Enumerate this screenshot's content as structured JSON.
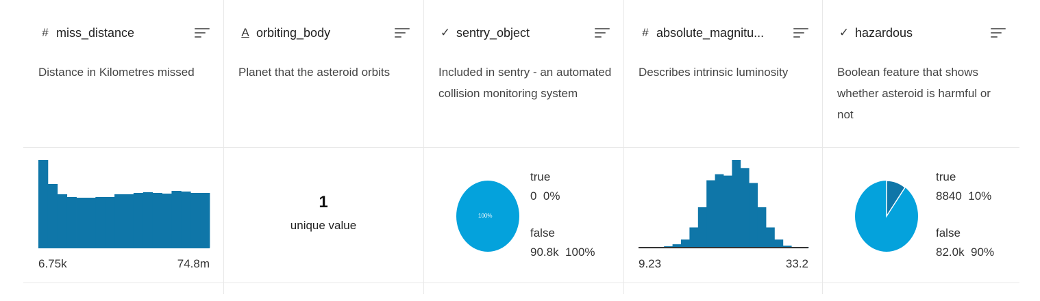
{
  "colors": {
    "histogram": "#0f76a8",
    "pie_main": "#04a2dc",
    "pie_minor": "#0f76a8",
    "grid": "#e8e8e8"
  },
  "columns": [
    {
      "type_icon": "#",
      "name": "miss_distance",
      "description": "Distance in Kilometres missed",
      "viz": "histogram",
      "axis_min": "6.75k",
      "axis_max": "74.8m"
    },
    {
      "type_icon": "A",
      "name": "orbiting_body",
      "description": "Planet that the asteroid orbits",
      "viz": "unique",
      "unique_count": "1",
      "unique_label": "unique value"
    },
    {
      "type_icon": "✓",
      "name": "sentry_object",
      "description": "Included in sentry - an automated collision monitoring system",
      "viz": "boolean",
      "pie_label": "100%",
      "true_label": "true",
      "true_stats": "0  0%",
      "false_label": "false",
      "false_stats": "90.8k  100%"
    },
    {
      "type_icon": "#",
      "name": "absolute_magnitu...",
      "description": "Describes intrinsic luminosity",
      "viz": "histogram",
      "axis_min": "9.23",
      "axis_max": "33.2"
    },
    {
      "type_icon": "✓",
      "name": "hazardous",
      "description": "Boolean feature that shows whether asteroid is harmful or not",
      "viz": "boolean",
      "true_label": "true",
      "true_stats": "8840  10%",
      "false_label": "false",
      "false_stats": "82.0k  90%"
    }
  ],
  "chart_data": [
    {
      "type": "bar",
      "series": [
        {
          "values": [
            128,
            93,
            78,
            74,
            73,
            73,
            74,
            74,
            78,
            78,
            80,
            81,
            80,
            79,
            83,
            82,
            80,
            80
          ]
        }
      ],
      "xlim": [
        "6.75k",
        "74.8m"
      ]
    },
    {
      "type": "bar",
      "series": [
        {
          "values": [
            1,
            1,
            1,
            2,
            5,
            12,
            30,
            60,
            100,
            109,
            107,
            130,
            118,
            96,
            60,
            30,
            12,
            3,
            1,
            1
          ]
        }
      ],
      "xlim": [
        "9.23",
        "33.2"
      ]
    },
    {
      "type": "pie",
      "categories": [
        "true",
        "false"
      ],
      "values": [
        0,
        100
      ]
    },
    {
      "type": "pie",
      "categories": [
        "true",
        "false"
      ],
      "values": [
        10,
        90
      ]
    }
  ]
}
